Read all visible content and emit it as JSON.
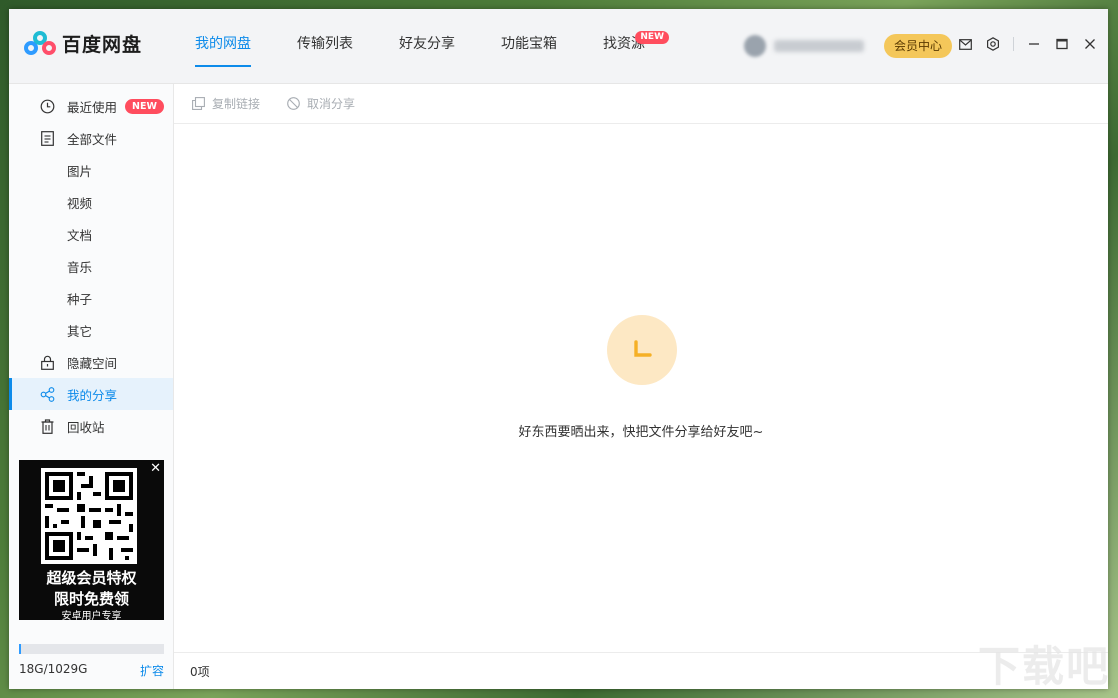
{
  "app": {
    "name": "百度网盘"
  },
  "nav": {
    "tabs": [
      {
        "label": "我的网盘"
      },
      {
        "label": "传输列表"
      },
      {
        "label": "好友分享"
      },
      {
        "label": "功能宝箱"
      },
      {
        "label": "找资源",
        "badge": "NEW"
      }
    ]
  },
  "header": {
    "vip_label": "会员中心"
  },
  "sidebar": {
    "items": [
      {
        "label": "最近使用",
        "badge": "NEW"
      },
      {
        "label": "全部文件"
      },
      {
        "label": "图片"
      },
      {
        "label": "视频"
      },
      {
        "label": "文档"
      },
      {
        "label": "音乐"
      },
      {
        "label": "种子"
      },
      {
        "label": "其它"
      },
      {
        "label": "隐藏空间"
      },
      {
        "label": "我的分享"
      },
      {
        "label": "回收站"
      }
    ],
    "promo": {
      "line1": "超级会员特权",
      "line2": "限时免费领",
      "line3": "安卓用户专享"
    },
    "storage": {
      "used_total": "18G/1029G",
      "used_fraction": 0.017,
      "expand_label": "扩容"
    }
  },
  "toolbar": {
    "copy_link": "复制链接",
    "cancel_share": "取消分享"
  },
  "main": {
    "empty_message": "好东西要晒出来，快把文件分享给好友吧~"
  },
  "status": {
    "count": "0项"
  },
  "colors": {
    "accent": "#0d8bea",
    "vip": "#f4c75a",
    "badge": "#ff4d5e",
    "clock": "#f5b026"
  },
  "watermark": "下载吧"
}
